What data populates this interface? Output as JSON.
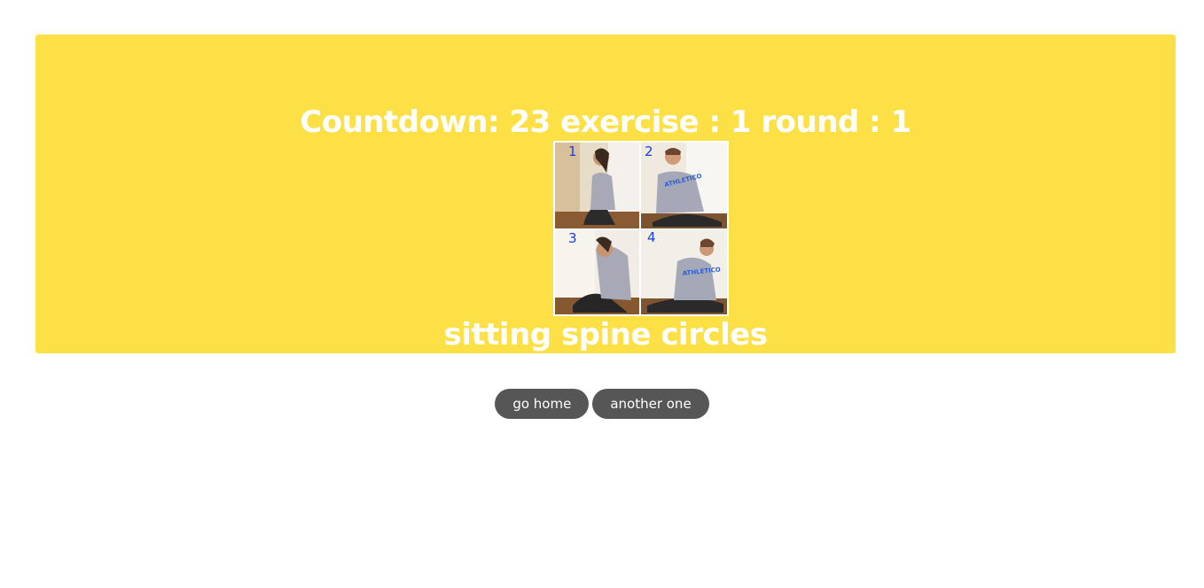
{
  "workout": {
    "countdown_label": "Countdown:",
    "countdown_value": "23",
    "exercise_label": "exercise :",
    "exercise_value": "1",
    "round_label": "round :",
    "round_value": "1",
    "exercise_name": "sitting spine circles"
  },
  "figure": {
    "panel_numbers": [
      "1",
      "2",
      "3",
      "4"
    ],
    "shirt_text": "ATHLETICO"
  },
  "actions": {
    "go_home_label": "go home",
    "another_one_label": "another one"
  },
  "colors": {
    "card_background": "#fce046",
    "button_background": "#565656",
    "text_on_card": "#ffffff",
    "panel_number_color": "#1a3fe0"
  }
}
